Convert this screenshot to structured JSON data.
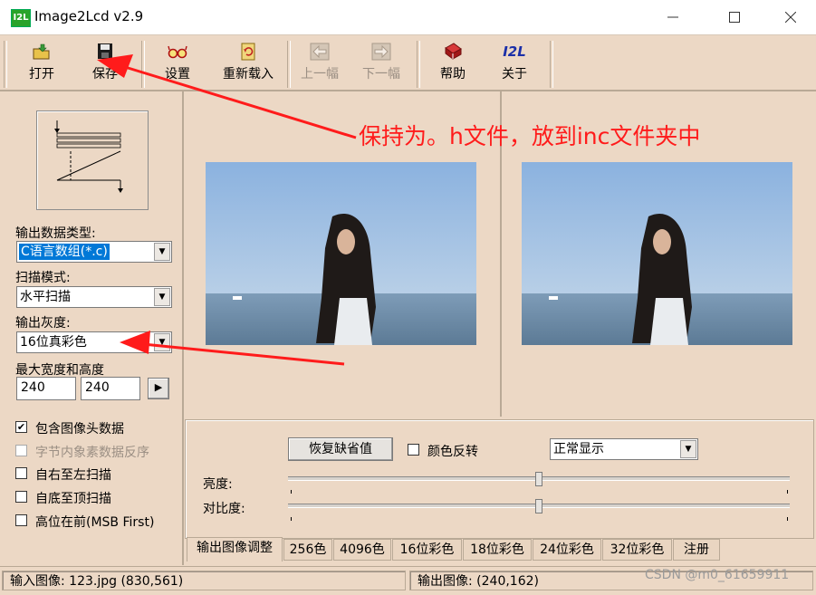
{
  "window": {
    "title": "Image2Lcd v2.9",
    "app_icon_text": "I2L"
  },
  "toolbar": {
    "items": [
      {
        "label": "打开",
        "icon": "open-folder-icon",
        "enabled": true
      },
      {
        "label": "保存",
        "icon": "save-disk-icon",
        "enabled": true
      },
      {
        "label": "设置",
        "icon": "settings-glasses-icon",
        "enabled": true
      },
      {
        "label": "重新载入",
        "icon": "reload-icon",
        "enabled": true
      },
      {
        "label": "上一幅",
        "icon": "previous-arrow-icon",
        "enabled": false
      },
      {
        "label": "下一幅",
        "icon": "next-arrow-icon",
        "enabled": false
      },
      {
        "label": "帮助",
        "icon": "help-book-icon",
        "enabled": true
      },
      {
        "label": "关于",
        "icon": "about-i2l-icon",
        "enabled": true
      }
    ],
    "about_icon_text": "I2L"
  },
  "left": {
    "output_type_label": "输出数据类型:",
    "output_type_value": "C语言数组(*.c)",
    "scan_mode_label": "扫描模式:",
    "scan_mode_value": "水平扫描",
    "gray_label": "输出灰度:",
    "gray_value": "16位真彩色",
    "max_size_label": "最大宽度和高度",
    "max_width": "240",
    "max_height": "240",
    "apply_button": "▶",
    "checkboxes": [
      {
        "label": "包含图像头数据",
        "checked": true,
        "enabled": true
      },
      {
        "label": "字节内象素数据反序",
        "checked": false,
        "enabled": false
      },
      {
        "label": "自右至左扫描",
        "checked": false,
        "enabled": true
      },
      {
        "label": "自底至顶扫描",
        "checked": false,
        "enabled": true
      },
      {
        "label": "高位在前(MSB First)",
        "checked": false,
        "enabled": true
      }
    ]
  },
  "adjust": {
    "restore_button": "恢复缺省值",
    "color_invert_label": "颜色反转",
    "color_invert_checked": false,
    "display_mode_value": "正常显示",
    "brightness_label": "亮度:",
    "contrast_label": "对比度:",
    "brightness_level": 0.5,
    "contrast_level": 0.5
  },
  "tabs": [
    {
      "label": "输出图像调整",
      "active": true
    },
    {
      "label": "256色",
      "active": false
    },
    {
      "label": "4096色",
      "active": false
    },
    {
      "label": "16位彩色",
      "active": false
    },
    {
      "label": "18位彩色",
      "active": false
    },
    {
      "label": "24位彩色",
      "active": false
    },
    {
      "label": "32位彩色",
      "active": false
    },
    {
      "label": "注册",
      "active": false
    }
  ],
  "status": {
    "input_image": "输入图像: 123.jpg (830,561)",
    "output_image": "输出图像: (240,162)"
  },
  "annotation": {
    "text": "保持为。h文件，放到inc文件夹中",
    "color": "#ff1b1b"
  },
  "watermark": "CSDN @m0_61659911",
  "colors": {
    "background": "#ecd8c5",
    "selection": "#0078d7",
    "annotation_red": "#ff1b1b"
  }
}
